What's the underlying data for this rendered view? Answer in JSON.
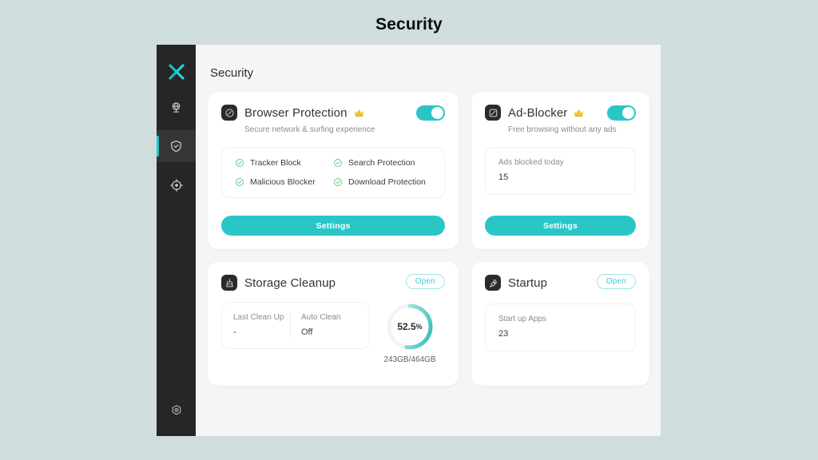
{
  "page": {
    "title": "Security"
  },
  "sidebar": {
    "logo": "x-logo",
    "items": [
      {
        "name": "network",
        "icon": "globe-icon",
        "active": false
      },
      {
        "name": "security",
        "icon": "shield-check-icon",
        "active": true
      },
      {
        "name": "tools",
        "icon": "target-icon",
        "active": false
      }
    ],
    "bottom": {
      "name": "settings",
      "icon": "gear-icon"
    }
  },
  "content": {
    "header": "Security"
  },
  "cards": {
    "browser_protection": {
      "icon": "compass-icon",
      "title": "Browser Protection",
      "badge": "crown-icon",
      "subtitle": "Secure network & surfing experience",
      "toggle": {
        "label": "browser-protection-toggle",
        "state": "on"
      },
      "features": [
        "Tracker Block",
        "Search Protection",
        "Malicious Blocker",
        "Download Protection"
      ],
      "button": "Settings"
    },
    "ad_blocker": {
      "icon": "ad-block-icon",
      "title": "Ad-Blocker",
      "badge": "crown-icon",
      "subtitle": "Free browsing without any ads",
      "toggle": {
        "label": "ad-blocker-toggle",
        "state": "on"
      },
      "stat_label": "Ads blocked today",
      "stat_value": "15",
      "button": "Settings"
    },
    "storage_cleanup": {
      "icon": "broom-icon",
      "title": "Storage Cleanup",
      "open_label": "Open",
      "last_clean_label": "Last Clean Up",
      "last_clean_value": "-",
      "auto_clean_label": "Auto Clean",
      "auto_clean_value": "Off",
      "usage_percent": "52.5",
      "usage_percent_symbol": "%",
      "usage_caption": "243GB/464GB"
    },
    "startup": {
      "icon": "rocket-icon",
      "title": "Startup",
      "open_label": "Open",
      "stat_label": "Start up Apps",
      "stat_value": "23"
    }
  },
  "colors": {
    "accent": "#2ac6c6",
    "page_background": "#cfdedd",
    "sidebar": "#262626",
    "content_background": "#f5f5f5",
    "check_green": "#56c87a",
    "crown_gold": "#f0c040"
  }
}
